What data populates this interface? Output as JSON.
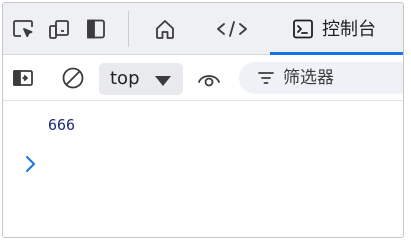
{
  "toolbar": {
    "icons": [
      "inspect-element-icon",
      "device-toolbar-icon",
      "dock-panel-icon",
      "elements-home-icon",
      "sources-code-icon"
    ],
    "active_tab": {
      "icon": "console-icon",
      "label": "控制台"
    },
    "accent_color": "#1a73e8"
  },
  "console_toolbar": {
    "context_selector": "top",
    "filter_placeholder": "筛选器"
  },
  "console": {
    "log_value": "666",
    "prompt_symbol": "chevron-right-icon"
  }
}
